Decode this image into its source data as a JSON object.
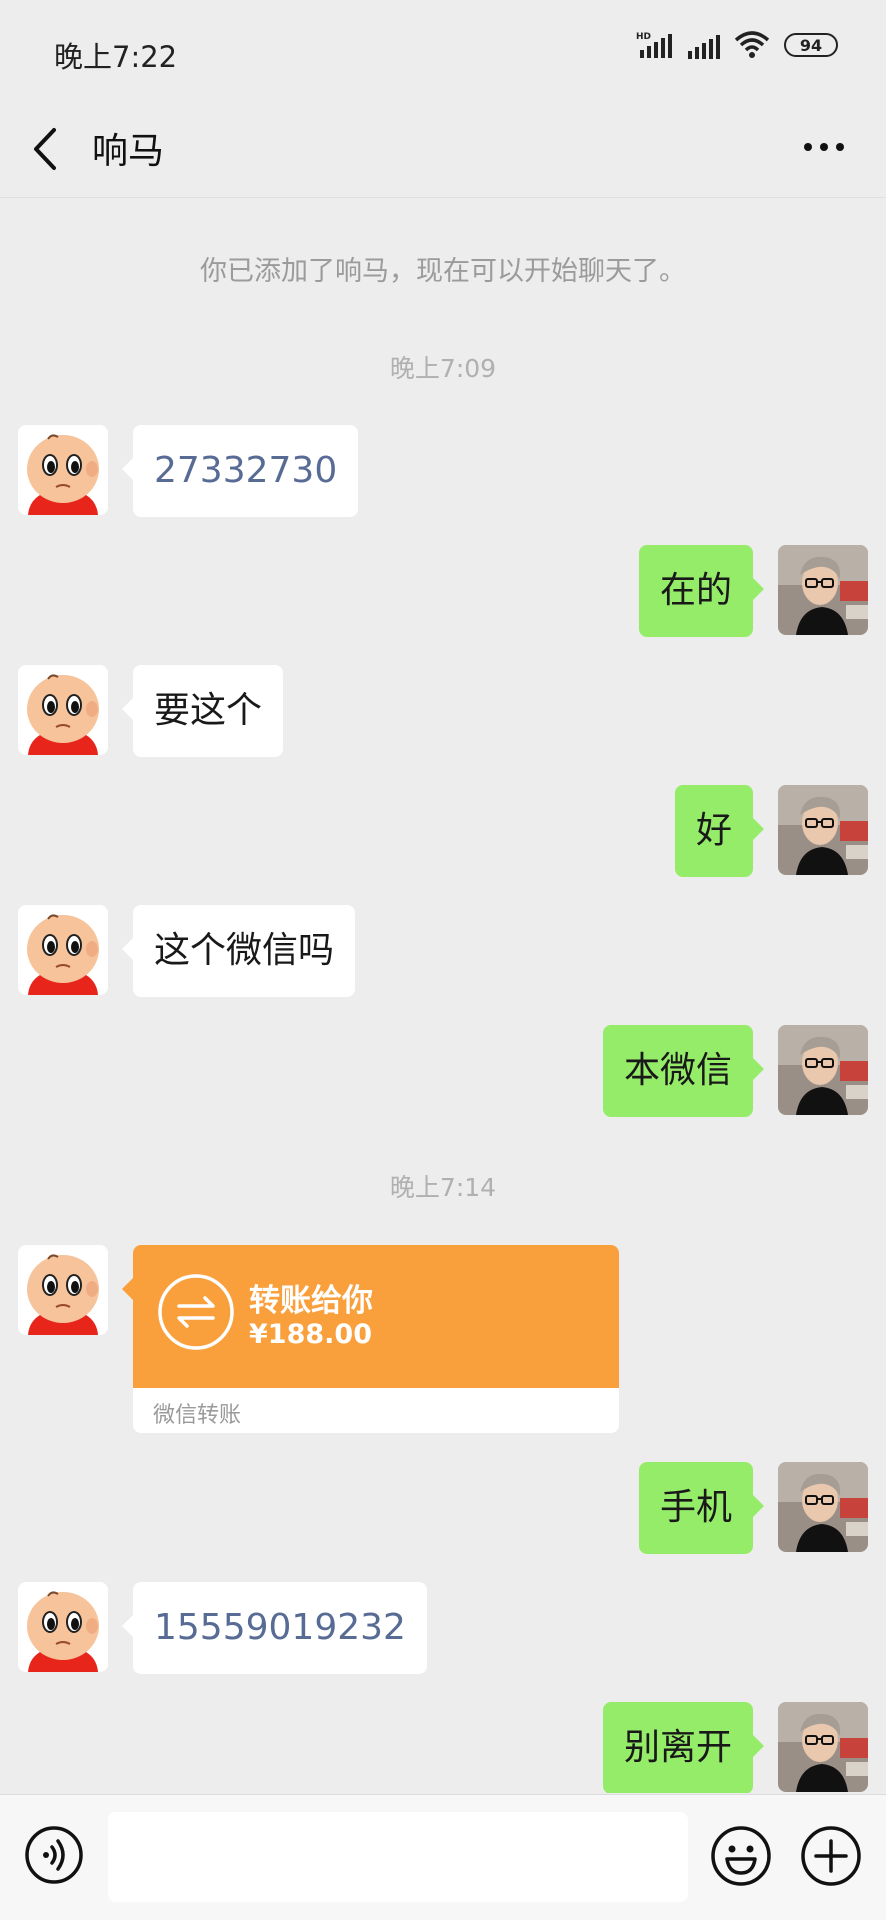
{
  "status_bar": {
    "time": "晚上7:22",
    "battery": "94",
    "icons": [
      "hd-signal-icon",
      "signal-icon",
      "wifi-icon",
      "battery-icon"
    ]
  },
  "header": {
    "title": "响马",
    "icons": [
      "back-arrow-icon",
      "more-icon"
    ]
  },
  "chat": {
    "system_notice": "你已添加了响马，现在可以开始聊天了。",
    "time_separators": [
      "晚上7:09",
      "晚上7:14"
    ],
    "messages": [
      {
        "from": "them",
        "text": "27332730"
      },
      {
        "from": "me",
        "text": "在的"
      },
      {
        "from": "them",
        "text": "要这个"
      },
      {
        "from": "me",
        "text": "好"
      },
      {
        "from": "them",
        "text": "这个微信吗"
      },
      {
        "from": "me",
        "text": "本微信"
      },
      {
        "from": "them",
        "type": "transfer",
        "title": "转账给你",
        "amount": "¥188.00",
        "footer": "微信转账"
      },
      {
        "from": "me",
        "text": "手机"
      },
      {
        "from": "them",
        "text": "15559019232"
      },
      {
        "from": "me",
        "text": "别离开"
      }
    ]
  },
  "input_bar": {
    "value": "",
    "icons": [
      "voice-icon",
      "emoji-icon",
      "plus-icon"
    ]
  },
  "colors": {
    "background": "#ededed",
    "outgoing_bubble": "#95ec69",
    "incoming_bubble": "#ffffff",
    "transfer_card": "#f9a03d",
    "link_number": "#576b95"
  }
}
